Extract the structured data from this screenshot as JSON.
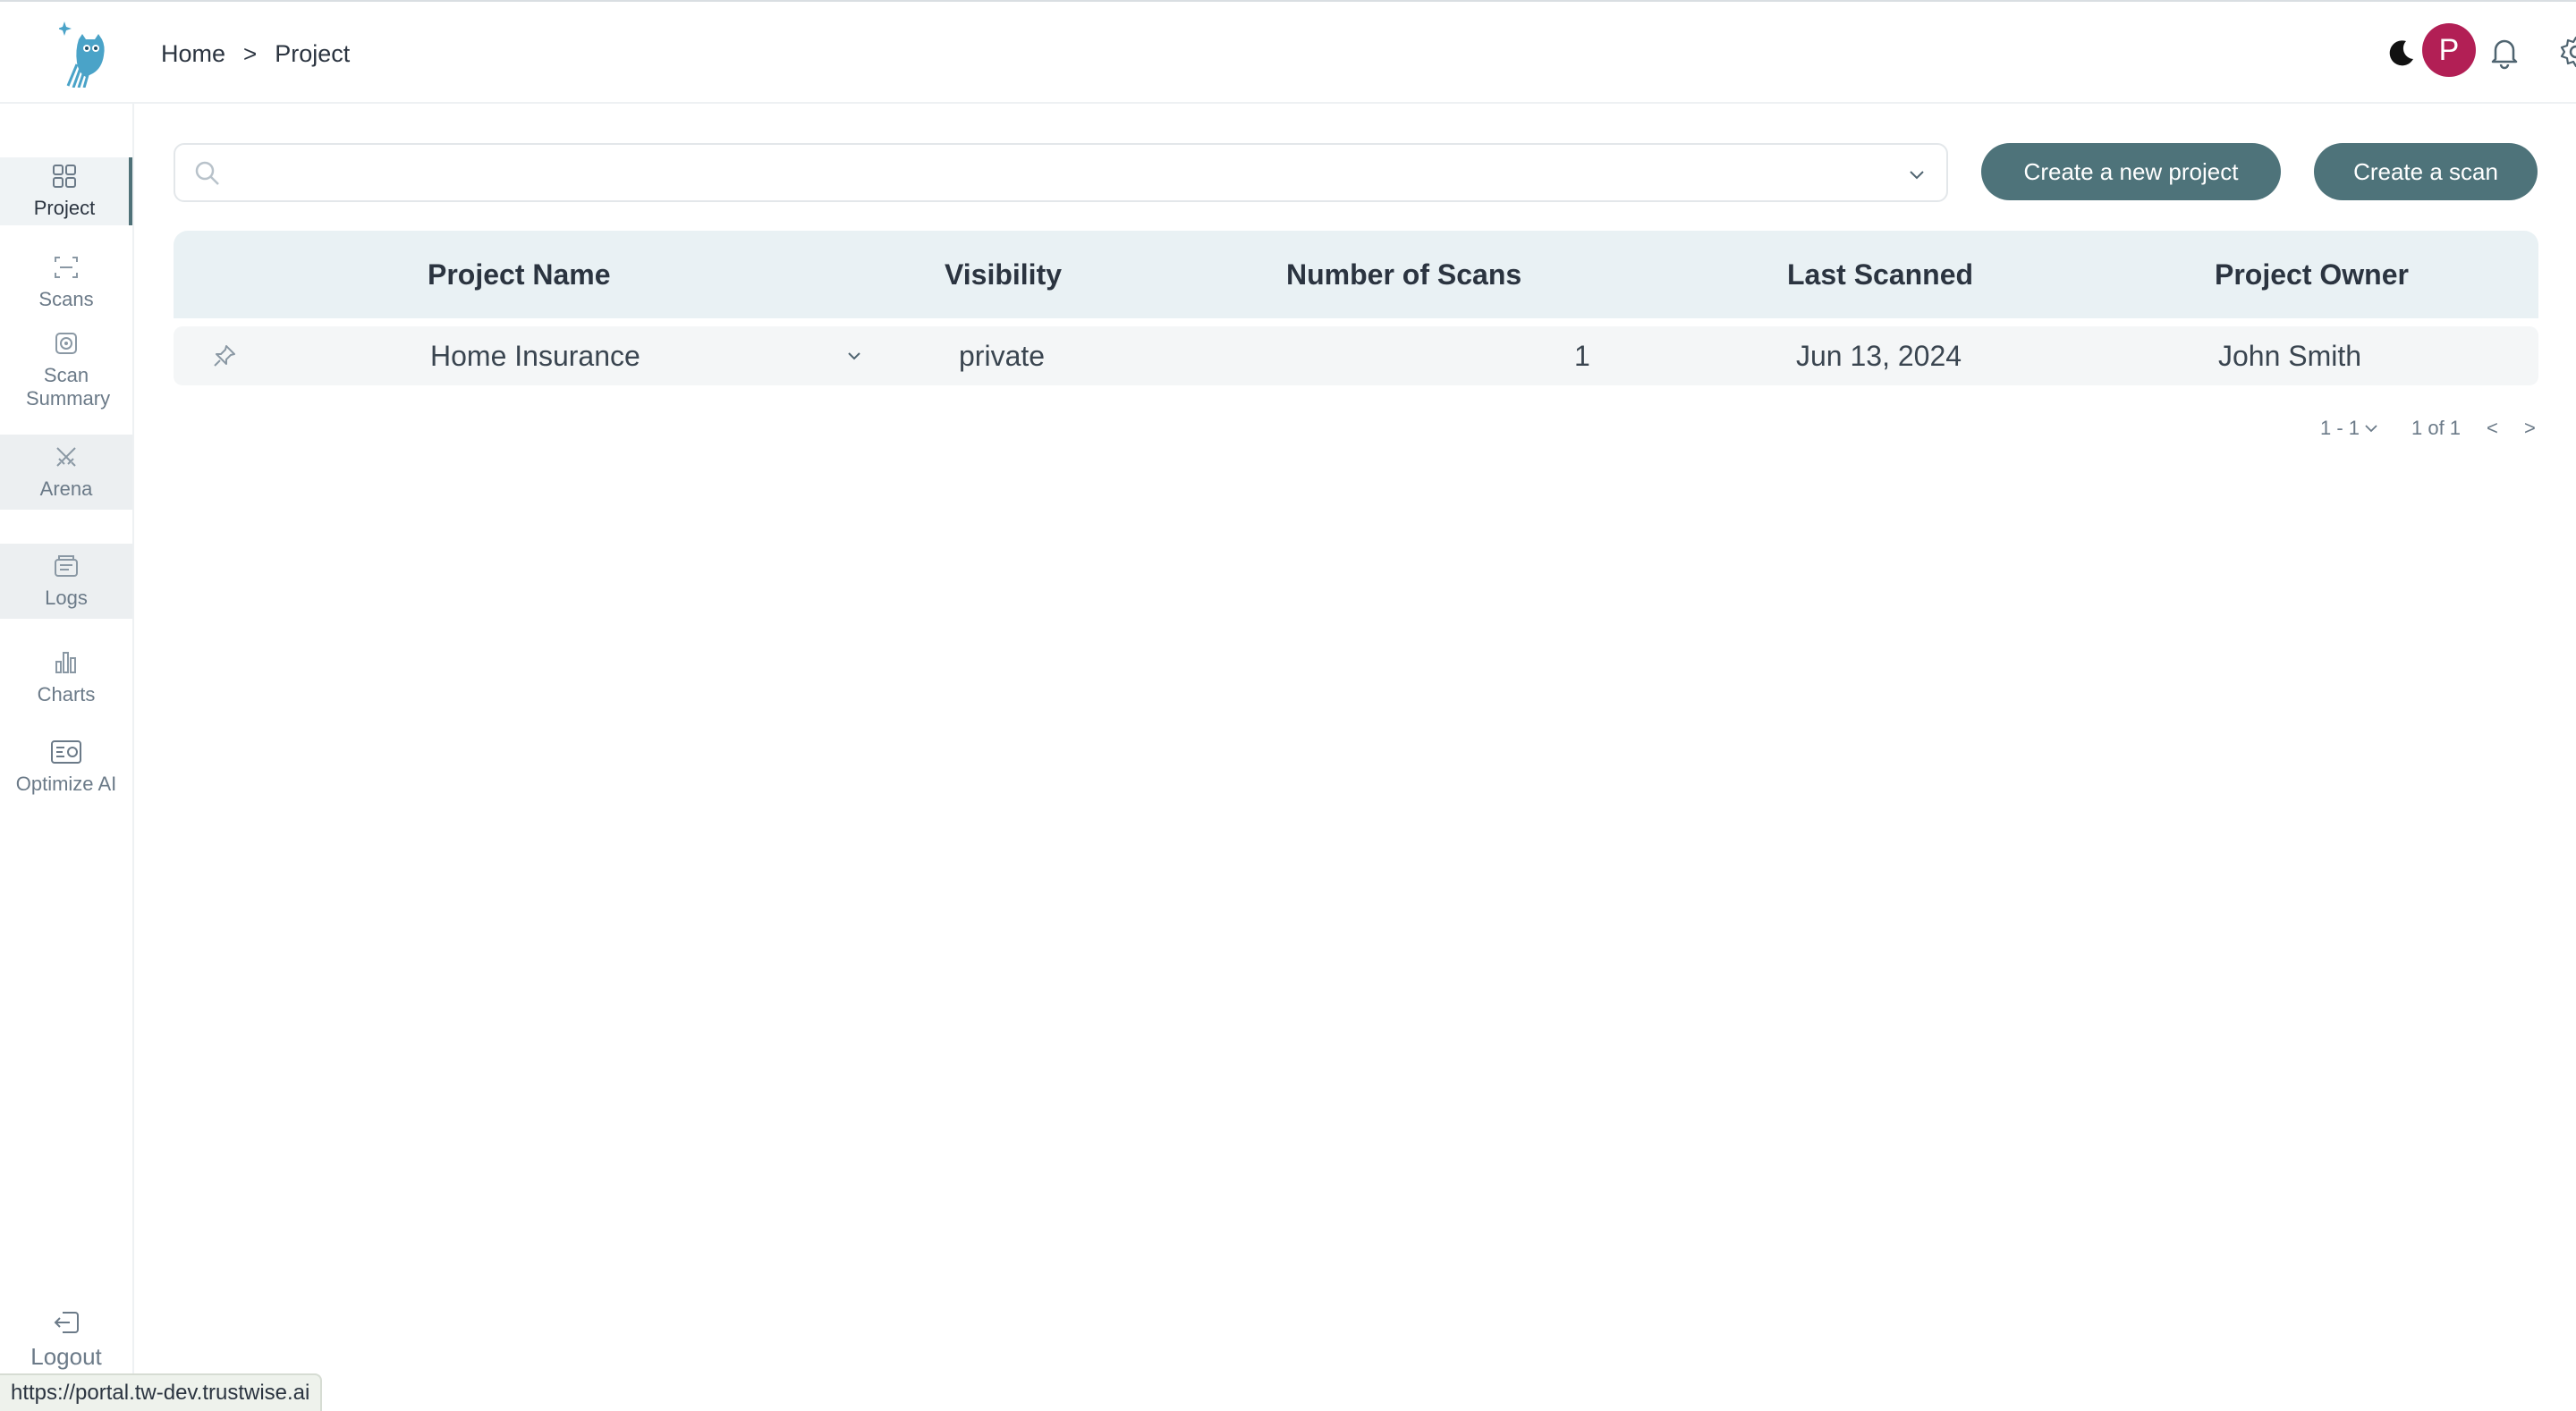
{
  "breadcrumb": {
    "home": "Home",
    "separator": ">",
    "current": "Project"
  },
  "header": {
    "avatar_letter": "P"
  },
  "sidebar": {
    "items": [
      {
        "label": "Project",
        "icon": "grid-icon"
      },
      {
        "label": "Scans",
        "icon": "scan-icon"
      },
      {
        "label": "Scan Summary",
        "icon": "scan-summary-icon"
      },
      {
        "label": "Arena",
        "icon": "swords-icon"
      },
      {
        "label": "Logs",
        "icon": "logs-icon"
      },
      {
        "label": "Charts",
        "icon": "bar-chart-icon"
      },
      {
        "label": "Optimize AI",
        "icon": "optimize-icon"
      }
    ],
    "logout": "Logout"
  },
  "search": {
    "placeholder": "",
    "value": ""
  },
  "buttons": {
    "create_project": "Create a new project",
    "create_scan": "Create a scan"
  },
  "table": {
    "columns": [
      "Project Name",
      "Visibility",
      "Number of Scans",
      "Last Scanned",
      "Project Owner"
    ],
    "rows": [
      {
        "name": "Home Insurance",
        "visibility": "private",
        "scans": "1",
        "last_scanned": "Jun 13, 2024",
        "owner": "John Smith"
      }
    ]
  },
  "pagination": {
    "page_size": "1 - 1",
    "range": "1 of 1",
    "prev": "<",
    "next": ">"
  },
  "status_bar": {
    "url": "https://portal.tw-dev.trustwise.ai"
  },
  "colors": {
    "accent": "#4e737a",
    "avatar": "#b21f55",
    "logo": "#4aa3c8"
  }
}
